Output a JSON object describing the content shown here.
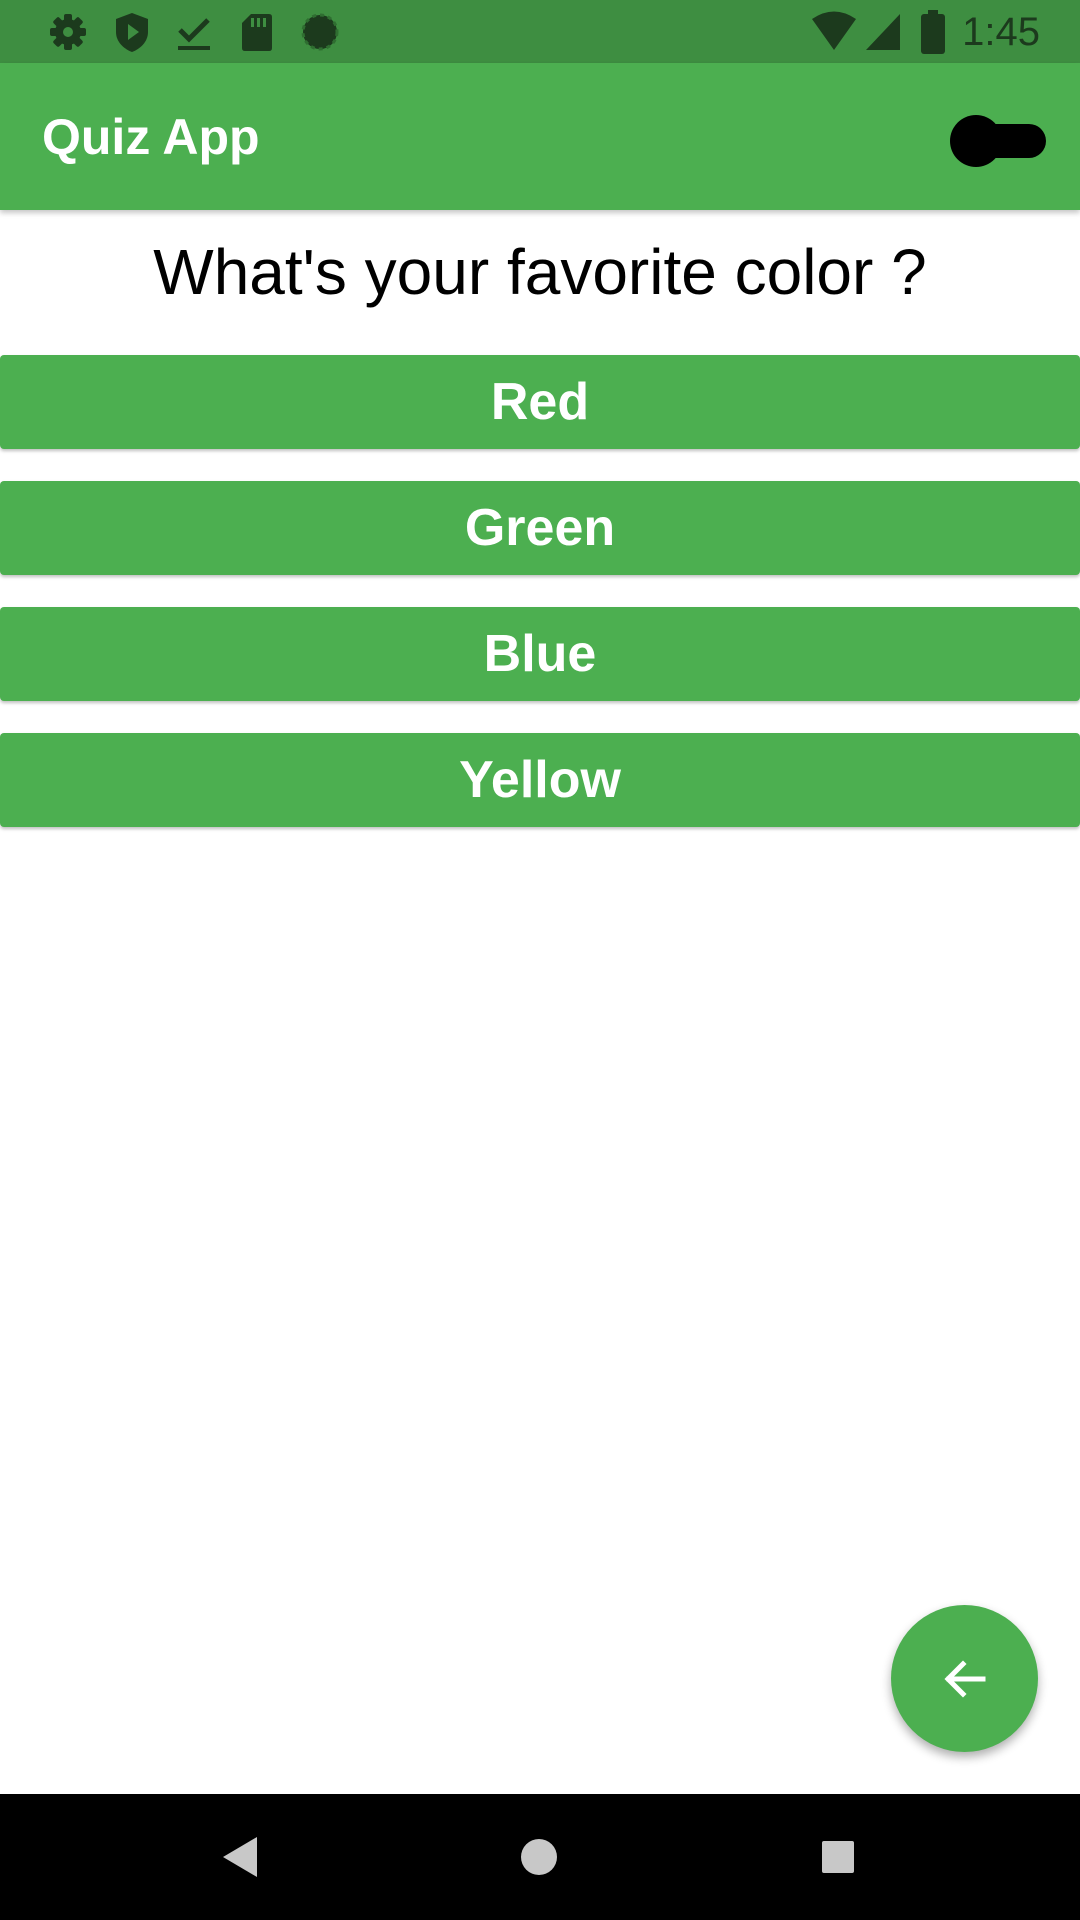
{
  "status_bar": {
    "time": "1:45",
    "left_icons": [
      "settings-icon",
      "shield-play-icon",
      "download-done-icon",
      "sd-card-icon",
      "sync-circle-icon"
    ],
    "right_icons": [
      "wifi-icon",
      "signal-icon",
      "battery-icon"
    ]
  },
  "app_bar": {
    "title": "Quiz App",
    "toggle_state": "off"
  },
  "question": {
    "text": "What's your favorite color ?"
  },
  "answers": [
    {
      "label": "Red"
    },
    {
      "label": "Green"
    },
    {
      "label": "Blue"
    },
    {
      "label": "Yellow"
    }
  ],
  "fab": {
    "icon": "arrow-back-icon"
  },
  "navigation_bar": {
    "buttons": [
      "back-icon",
      "home-icon",
      "recents-icon"
    ]
  },
  "colors": {
    "primary": "#4caf50",
    "status_bar": "#3e8e41",
    "text_on_primary": "#ffffff"
  }
}
